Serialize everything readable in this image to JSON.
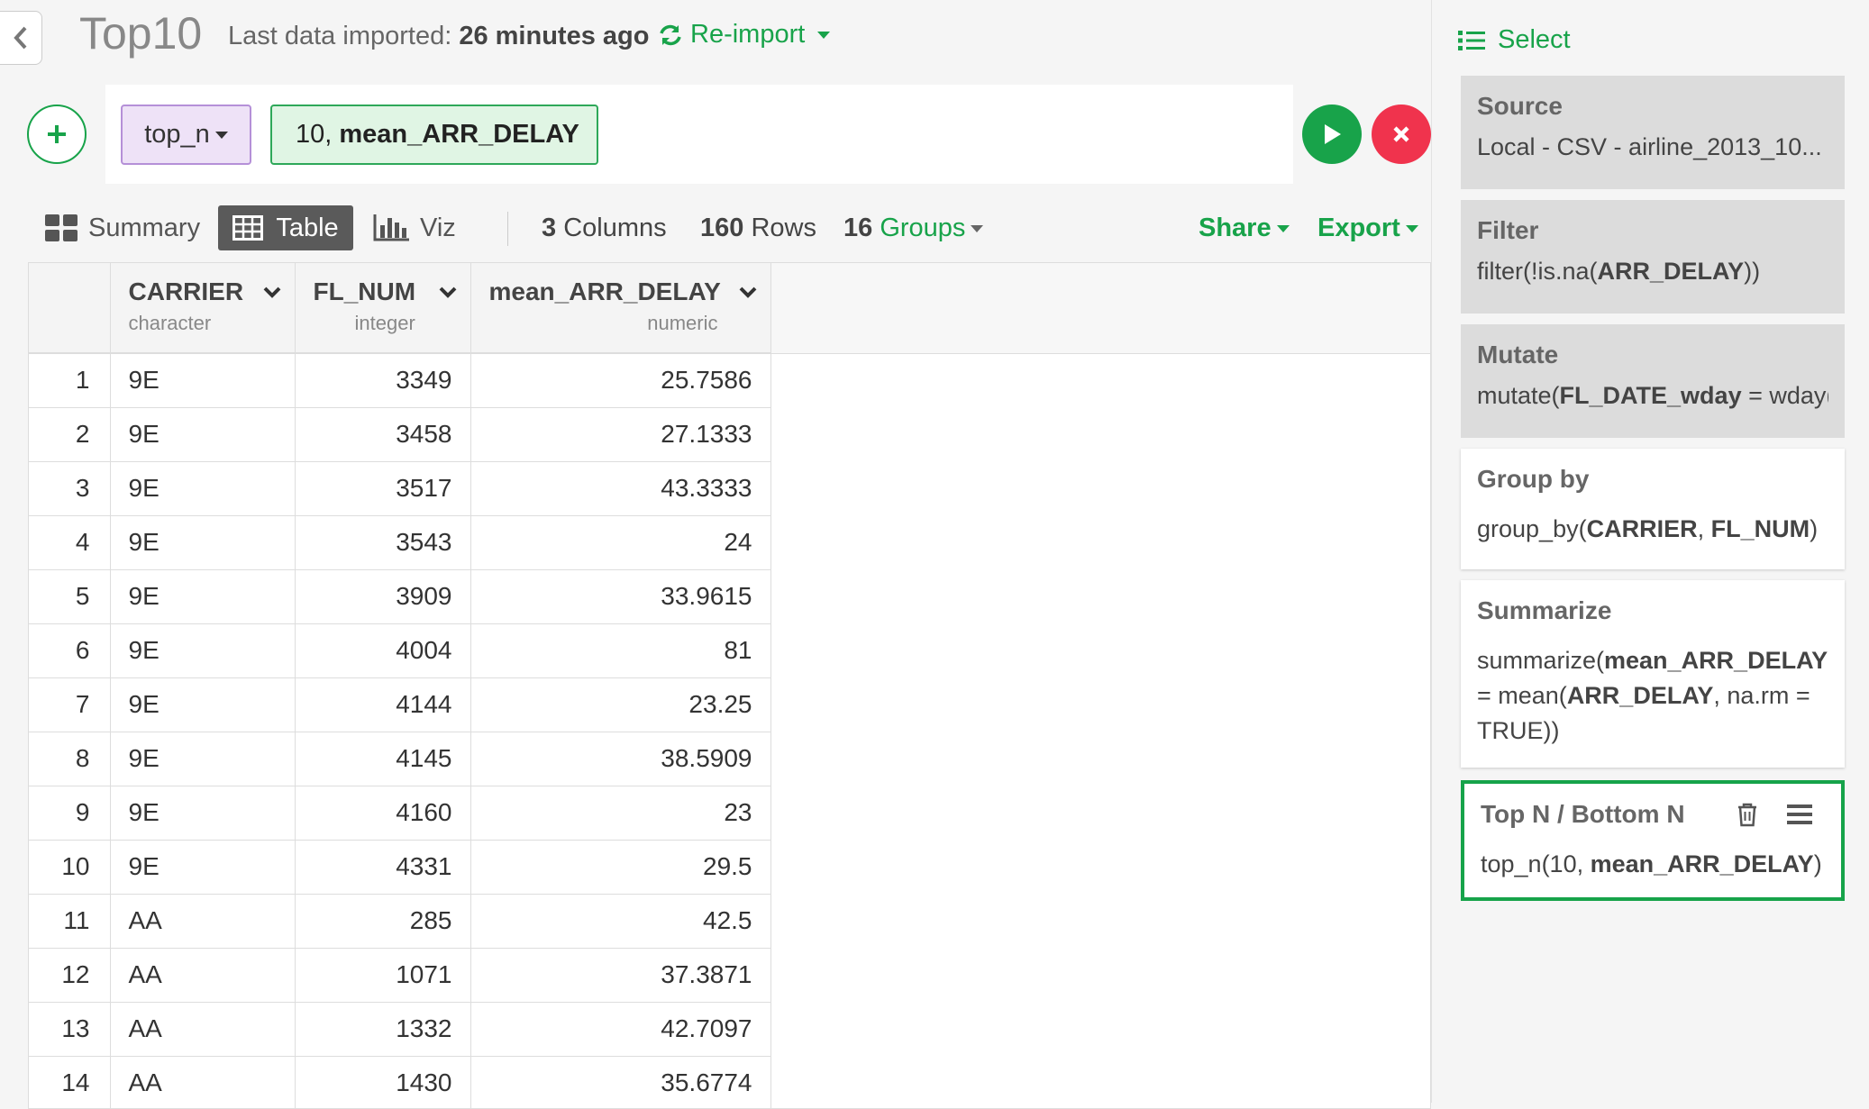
{
  "header": {
    "title": "Top10",
    "last_import_label": "Last data imported:",
    "last_import_value": "26 minutes ago",
    "reimport_label": "Re-import"
  },
  "command": {
    "function_token": "top_n",
    "arg_prefix": "10,",
    "arg_column": "mean_ARR_DELAY"
  },
  "toolbar": {
    "tabs": [
      "Summary",
      "Table",
      "Viz"
    ],
    "columns_num": "3",
    "columns_label": "Columns",
    "rows_num": "160",
    "rows_label": "Rows",
    "groups_num": "16",
    "groups_label": "Groups",
    "share_label": "Share",
    "export_label": "Export"
  },
  "table": {
    "columns": [
      {
        "name": "CARRIER",
        "type": "character"
      },
      {
        "name": "FL_NUM",
        "type": "integer"
      },
      {
        "name": "mean_ARR_DELAY",
        "type": "numeric"
      }
    ],
    "rows": [
      [
        "1",
        "9E",
        "3349",
        "25.7586"
      ],
      [
        "2",
        "9E",
        "3458",
        "27.1333"
      ],
      [
        "3",
        "9E",
        "3517",
        "43.3333"
      ],
      [
        "4",
        "9E",
        "3543",
        "24"
      ],
      [
        "5",
        "9E",
        "3909",
        "33.9615"
      ],
      [
        "6",
        "9E",
        "4004",
        "81"
      ],
      [
        "7",
        "9E",
        "4144",
        "23.25"
      ],
      [
        "8",
        "9E",
        "4145",
        "38.5909"
      ],
      [
        "9",
        "9E",
        "4160",
        "23"
      ],
      [
        "10",
        "9E",
        "4331",
        "29.5"
      ],
      [
        "11",
        "AA",
        "285",
        "42.5"
      ],
      [
        "12",
        "AA",
        "1071",
        "37.3871"
      ],
      [
        "13",
        "AA",
        "1332",
        "42.7097"
      ],
      [
        "14",
        "AA",
        "1430",
        "35.6774"
      ]
    ]
  },
  "steps_panel": {
    "select_label": "Select",
    "source_title": "Source",
    "source_body": "Local - CSV - airline_2013_10...",
    "filter_title": "Filter",
    "filter_pre": "filter(!is.na(",
    "filter_bold": "ARR_DELAY",
    "filter_post": "))",
    "mutate_title": "Mutate",
    "mutate_pre": "mutate(",
    "mutate_bold": "FL_DATE_wday",
    "mutate_post": " = wday(",
    "group_title": "Group by",
    "group_pre": "group_by(",
    "group_b1": "CARRIER",
    "group_mid": ", ",
    "group_b2": "FL_NUM",
    "group_post": ")",
    "summarize_title": "Summarize",
    "sum_pre": "summarize(",
    "sum_b1": "mean_ARR_DELAY",
    "sum_mid": " = mean(",
    "sum_b2": "ARR_DELAY",
    "sum_post": ", na.rm = TRUE))",
    "topn_title": "Top N / Bottom N",
    "topn_pre": "top_n(10, ",
    "topn_bold": "mean_ARR_DELAY",
    "topn_post": ")"
  },
  "colors": {
    "accent": "#18a34a",
    "danger": "#f0334d",
    "token_purple": "#eee2f7",
    "token_green": "#e0f5e4"
  }
}
